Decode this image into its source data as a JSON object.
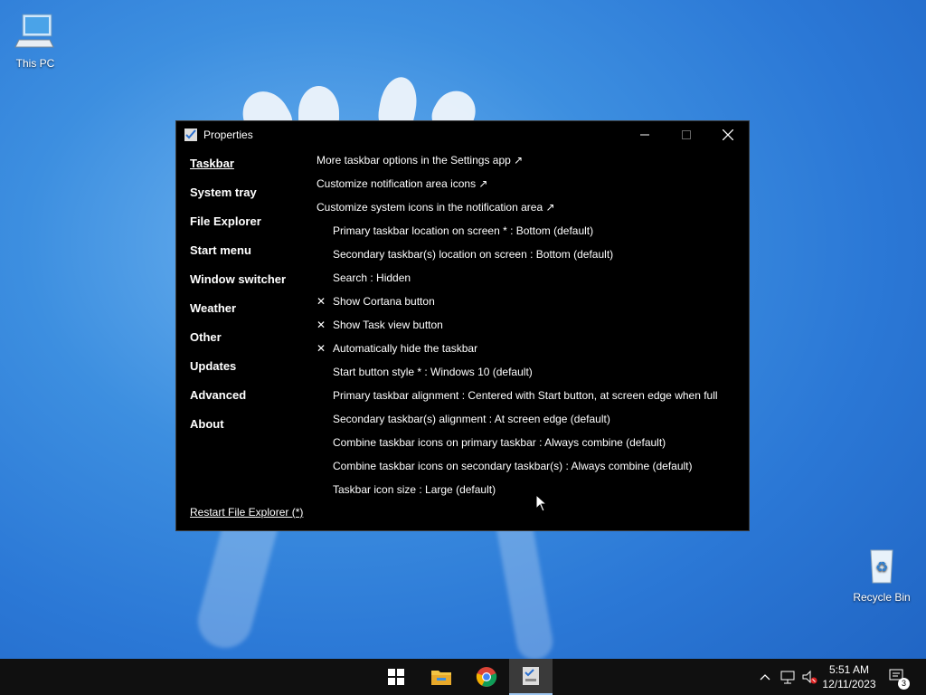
{
  "desktop": {
    "this_pc_label": "This PC",
    "recycle_bin_label": "Recycle Bin"
  },
  "window": {
    "title": "Properties",
    "nav": [
      {
        "label": "Taskbar",
        "active": true
      },
      {
        "label": "System tray"
      },
      {
        "label": "File Explorer"
      },
      {
        "label": "Start menu"
      },
      {
        "label": "Window switcher"
      },
      {
        "label": "Weather"
      },
      {
        "label": "Other"
      },
      {
        "label": "Updates"
      },
      {
        "label": "Advanced"
      },
      {
        "label": "About"
      }
    ],
    "restart_label": "Restart File Explorer (*)",
    "options": [
      {
        "label": "More taskbar options in the Settings app ↗",
        "type": "link"
      },
      {
        "label": "Customize notification area icons ↗",
        "type": "link"
      },
      {
        "label": "Customize system icons in the notification area ↗",
        "type": "link"
      },
      {
        "label": "Primary taskbar location on screen * : Bottom (default)",
        "type": "select"
      },
      {
        "label": "Secondary taskbar(s) location on screen : Bottom (default)",
        "type": "select"
      },
      {
        "label": "Search : Hidden",
        "type": "select"
      },
      {
        "label": "Show Cortana button",
        "type": "check",
        "mark": "✕"
      },
      {
        "label": "Show Task view button",
        "type": "check",
        "mark": "✕"
      },
      {
        "label": "Automatically hide the taskbar",
        "type": "check",
        "mark": "✕"
      },
      {
        "label": "Start button style * : Windows 10 (default)",
        "type": "select"
      },
      {
        "label": "Primary taskbar alignment : Centered with Start button, at screen edge when full",
        "type": "select"
      },
      {
        "label": "Secondary taskbar(s) alignment : At screen edge (default)",
        "type": "select"
      },
      {
        "label": "Combine taskbar icons on primary taskbar : Always combine (default)",
        "type": "select"
      },
      {
        "label": "Combine taskbar icons on secondary taskbar(s) : Always combine (default)",
        "type": "select"
      },
      {
        "label": "Taskbar icon size : Large (default)",
        "type": "select"
      }
    ]
  },
  "taskbar": {
    "time": "5:51 AM",
    "date": "12/11/2023",
    "notification_count": "3"
  }
}
